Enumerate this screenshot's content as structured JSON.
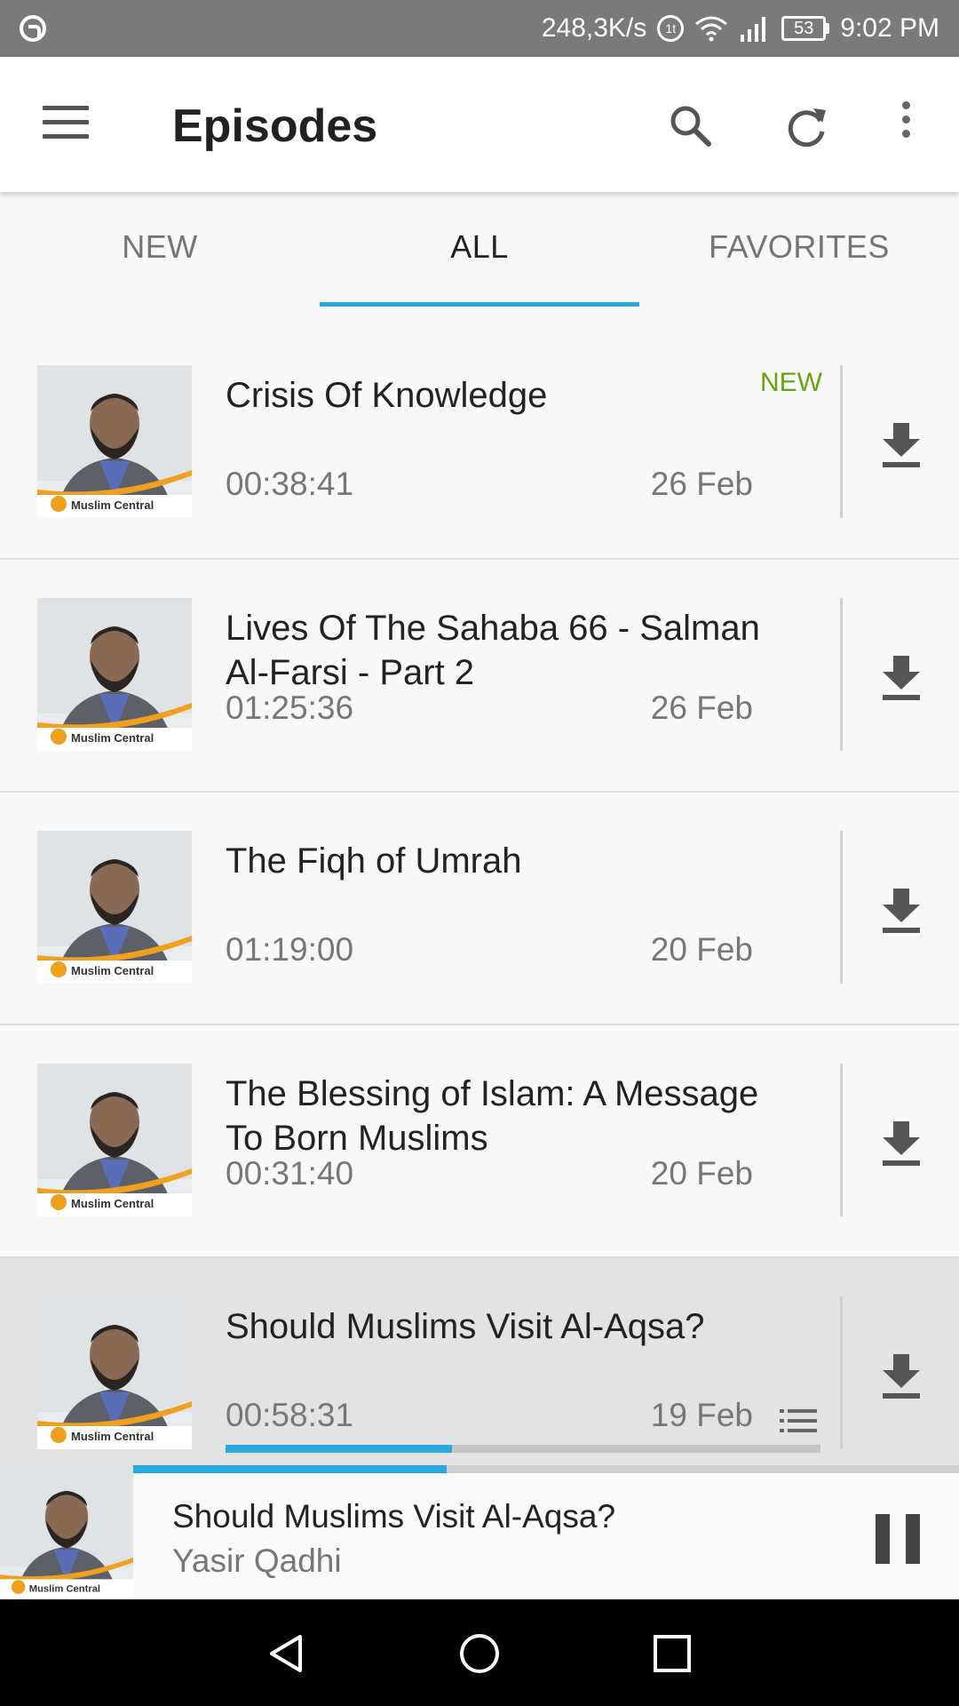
{
  "status_bar": {
    "net_speed": "248,3K/s",
    "data_indicator": "1t",
    "battery": "53",
    "time": "9:02 PM"
  },
  "app_bar": {
    "title": "Episodes",
    "icons": [
      "menu-icon",
      "search-icon",
      "refresh-icon",
      "more-vert-icon"
    ]
  },
  "tabs": [
    {
      "label": "NEW",
      "active": false
    },
    {
      "label": "ALL",
      "active": true
    },
    {
      "label": "FAVORITES",
      "active": false
    }
  ],
  "episodes": [
    {
      "title": "Crisis Of Knowledge",
      "badge": "NEW",
      "duration": "00:38:41",
      "date": "26 Feb"
    },
    {
      "title": "Lives Of The Sahaba 66 - Salman Al-Farsi - Part 2",
      "badge": "",
      "duration": "01:25:36",
      "date": "26 Feb"
    },
    {
      "title": "The Fiqh of Umrah",
      "badge": "",
      "duration": "01:19:00",
      "date": "20 Feb"
    },
    {
      "title": "The Blessing of Islam: A Message To Born Muslims",
      "badge": "",
      "duration": "00:31:40",
      "date": "20 Feb"
    },
    {
      "title": "Should Muslims Visit Al-Aqsa?",
      "badge": "",
      "duration": "00:58:31",
      "date": "19 Feb",
      "progress_fraction": 0.38,
      "in_playlist": true
    }
  ],
  "thumbnail_brand": "Muslim Central",
  "player": {
    "title": "Should Muslims Visit Al-Aqsa?",
    "artist": "Yasir Qadhi",
    "progress_fraction": 0.38
  },
  "colors": {
    "accent": "#29a9e0",
    "new_badge": "#6aa214",
    "status_bar": "#7a7a7a",
    "brand_orange": "#f0a01e"
  }
}
